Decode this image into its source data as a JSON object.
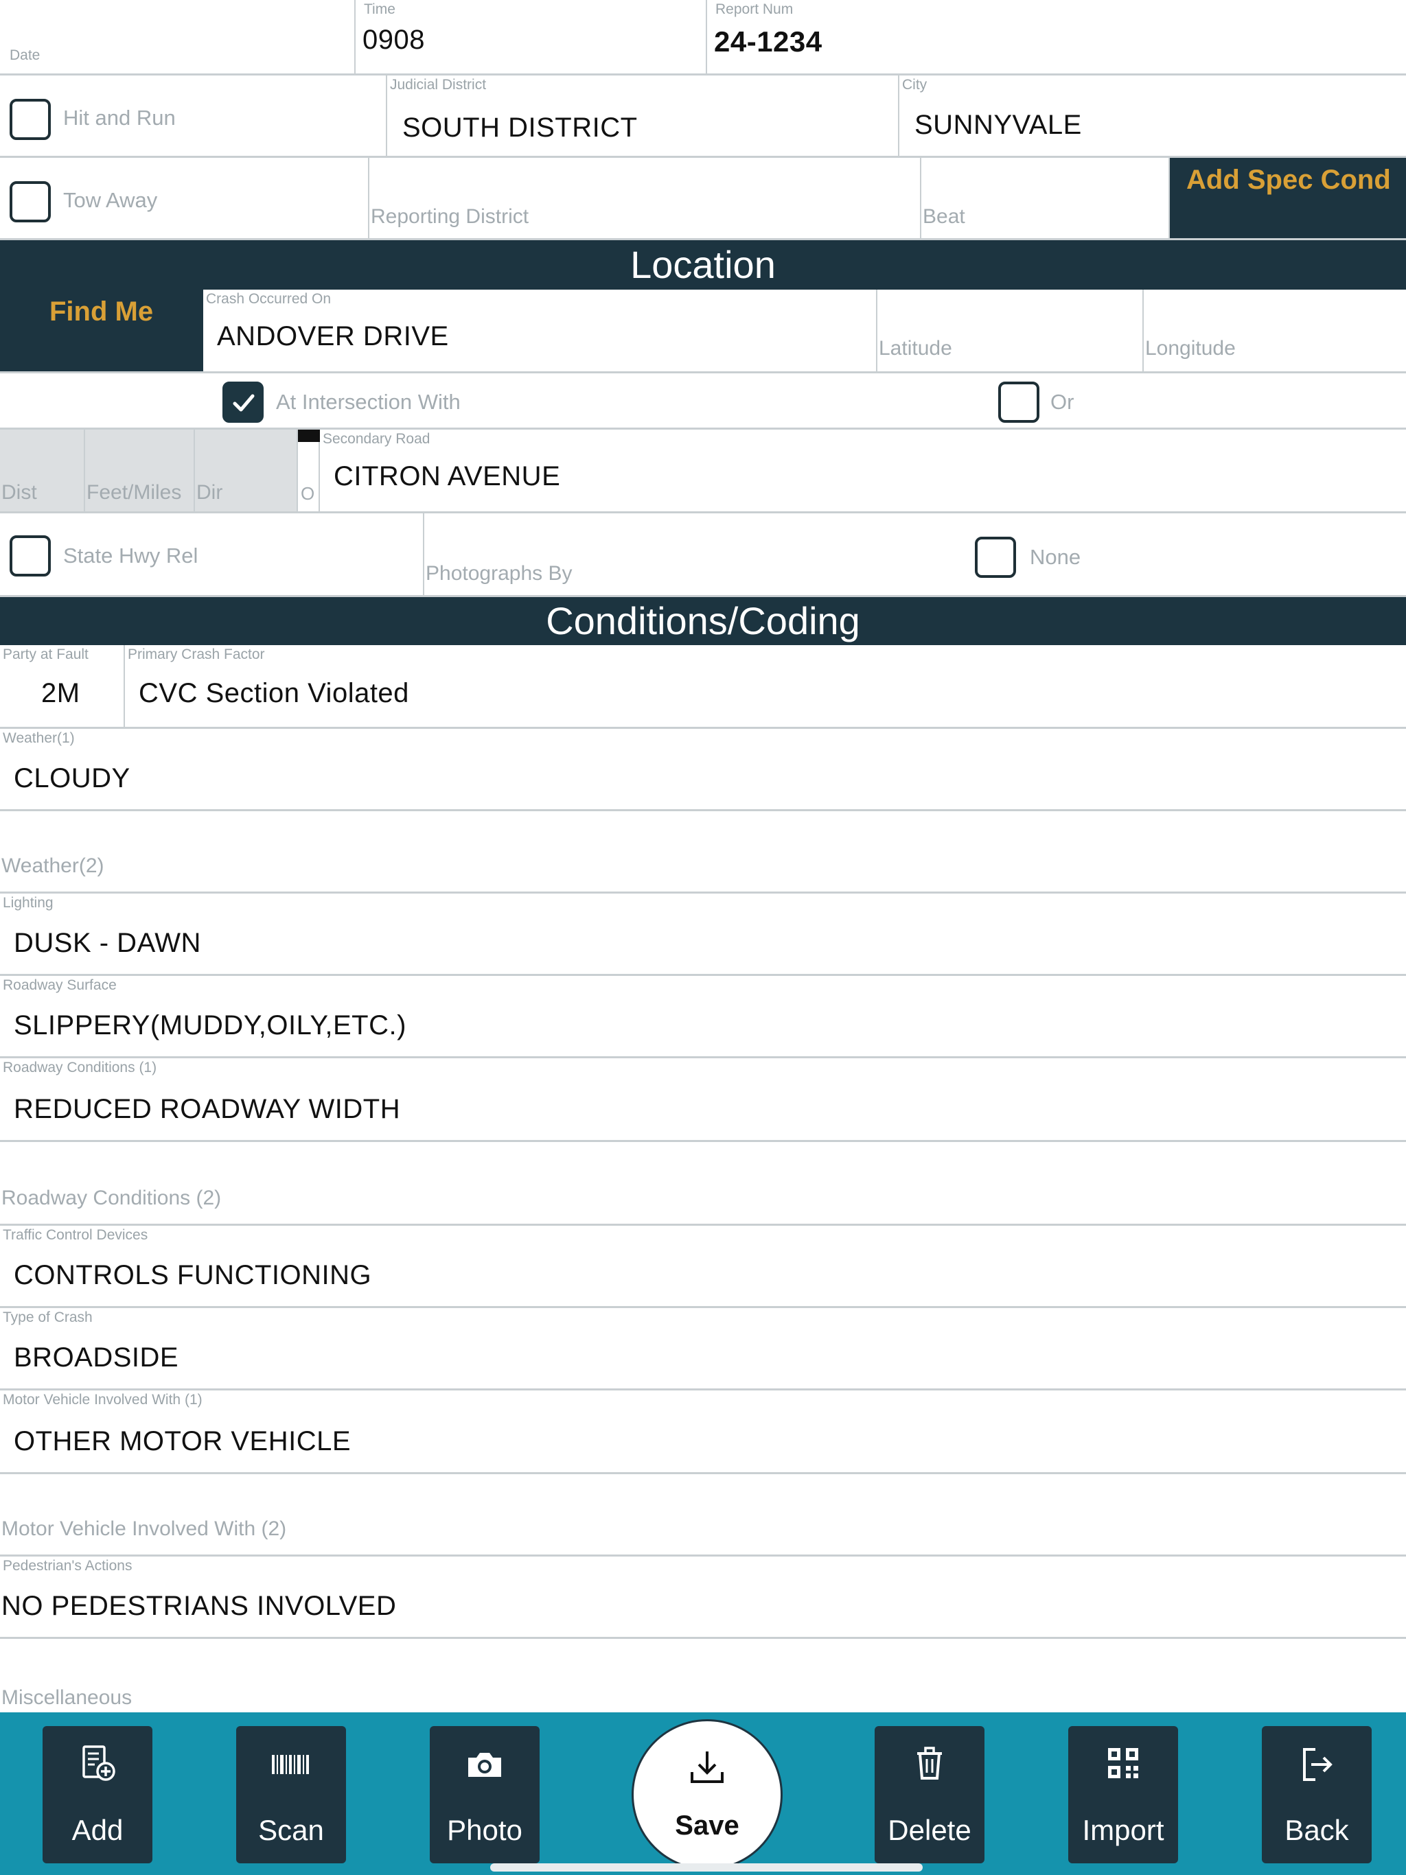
{
  "header": {
    "date_label": "Date",
    "time_label": "Time",
    "time_value": "0908",
    "report_label": "Report Num",
    "report_value": "24-1234"
  },
  "flags": {
    "hit_and_run_label": "Hit and Run",
    "hit_and_run_checked": false,
    "tow_away_label": "Tow Away",
    "tow_away_checked": false
  },
  "district": {
    "judicial_label": "Judicial District",
    "judicial_value": "SOUTH DISTRICT",
    "city_label": "City",
    "city_value": "SUNNYVALE",
    "reporting_label": "Reporting District",
    "beat_label": "Beat",
    "add_spec_cond_label": "Add Spec Cond"
  },
  "location": {
    "title": "Location",
    "find_me_label": "Find Me",
    "crash_label": "Crash Occurred On",
    "crash_value": "ANDOVER DRIVE",
    "latitude_label": "Latitude",
    "longitude_label": "Longitude",
    "intersection_label": "At Intersection With",
    "intersection_checked": true,
    "or_label": "Or",
    "or_checked": false,
    "dist_label": "Dist",
    "feet_miles_label": "Feet/Miles",
    "dir_label": "Dir",
    "of_label": "O",
    "secondary_label": "Secondary Road",
    "secondary_value": "CITRON AVENUE",
    "state_hwy_label": "State Hwy Rel",
    "state_hwy_checked": false,
    "photographs_label": "Photographs By",
    "none_label": "None",
    "none_checked": false
  },
  "conditions": {
    "title": "Conditions/Coding",
    "party_label": "Party at Fault",
    "party_value": "2M",
    "pcf_label": "Primary Crash Factor",
    "pcf_value": "CVC Section Violated",
    "fields": [
      {
        "label": "Weather(1)",
        "value": "CLOUDY"
      },
      {
        "label": "Weather(2)",
        "value": ""
      },
      {
        "label": "Lighting",
        "value": "DUSK - DAWN"
      },
      {
        "label": "Roadway Surface",
        "value": "SLIPPERY(MUDDY,OILY,ETC.)"
      },
      {
        "label": "Roadway Conditions (1)",
        "value": "REDUCED ROADWAY WIDTH"
      },
      {
        "label": "Roadway Conditions (2)",
        "value": ""
      },
      {
        "label": "Traffic Control Devices",
        "value": "CONTROLS FUNCTIONING"
      },
      {
        "label": "Type of Crash",
        "value": "BROADSIDE"
      },
      {
        "label": "Motor Vehicle Involved With (1)",
        "value": "OTHER MOTOR VEHICLE"
      },
      {
        "label": "Motor Vehicle Involved With (2)",
        "value": ""
      },
      {
        "label": "Pedestrian's Actions",
        "value": "NO PEDESTRIANS INVOLVED"
      },
      {
        "label": "Miscellaneous",
        "value": ""
      }
    ]
  },
  "toolbar": {
    "add": "Add",
    "scan": "Scan",
    "photo": "Photo",
    "save": "Save",
    "delete": "Delete",
    "import": "Import",
    "back": "Back"
  }
}
